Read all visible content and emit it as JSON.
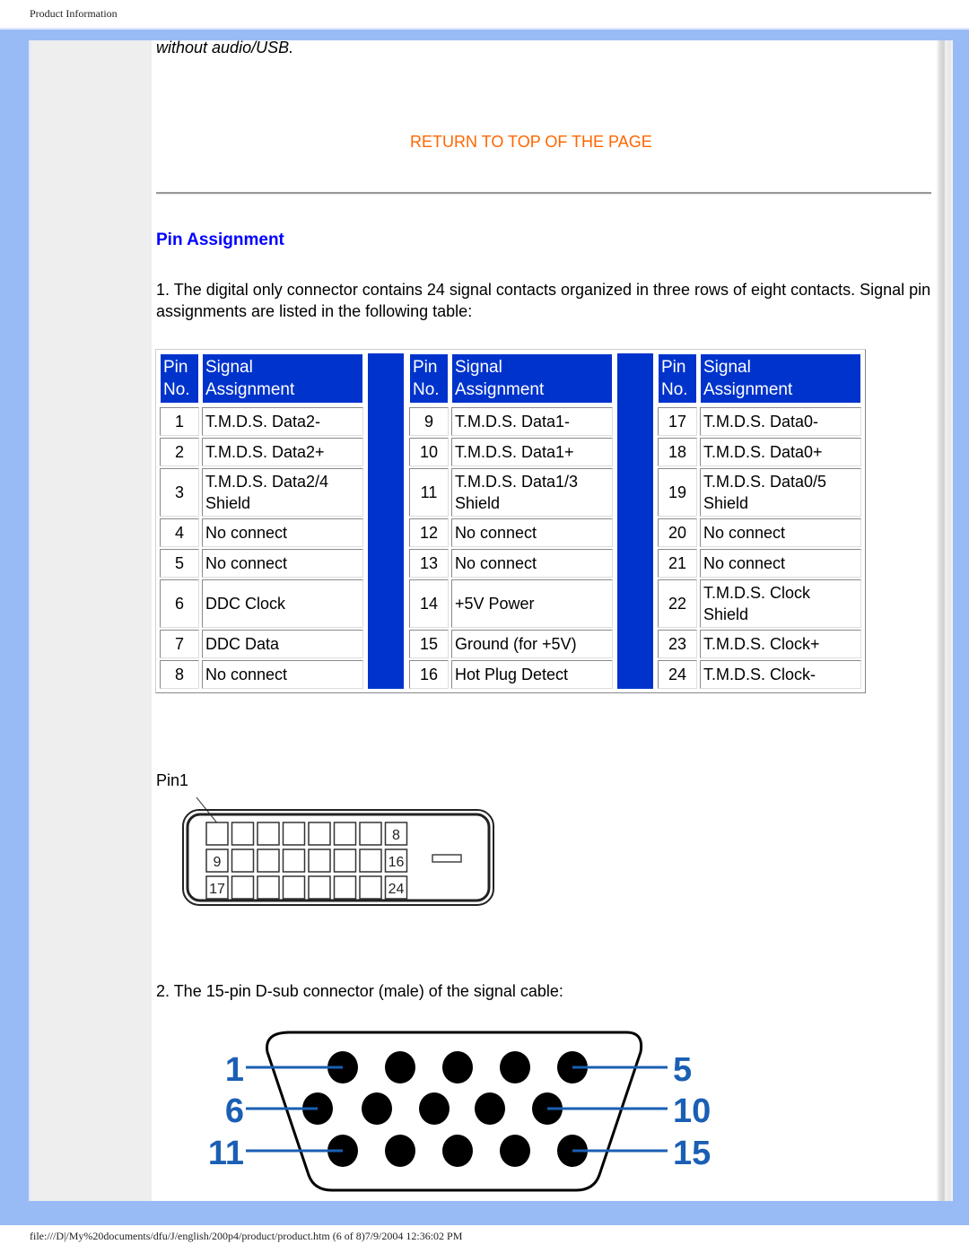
{
  "header": {
    "title": "Product Information"
  },
  "content": {
    "intro_italic": "without audio/USB.",
    "return_link": "RETURN TO TOP OF THE PAGE",
    "section_title": "Pin Assignment",
    "para1": "1. The digital only connector contains 24 signal contacts organized in three rows of eight contacts. Signal pin assignments are listed in the following table:",
    "table": {
      "header_pin": [
        "Pin",
        "No."
      ],
      "header_signal": [
        "Signal",
        "Assignment"
      ],
      "groups": [
        {
          "rows": [
            {
              "pin": "1",
              "signal": [
                "T.M.D.S. Data2-"
              ]
            },
            {
              "pin": "2",
              "signal": [
                "T.M.D.S. Data2+"
              ]
            },
            {
              "pin": "3",
              "signal": [
                "T.M.D.S. Data2/4",
                "Shield"
              ]
            },
            {
              "pin": "4",
              "signal": [
                "No connect"
              ]
            },
            {
              "pin": "5",
              "signal": [
                "No connect"
              ]
            },
            {
              "pin": "6",
              "signal": [
                "DDC Clock"
              ]
            },
            {
              "pin": "7",
              "signal": [
                "DDC Data"
              ]
            },
            {
              "pin": "8",
              "signal": [
                "No connect"
              ]
            }
          ]
        },
        {
          "rows": [
            {
              "pin": "9",
              "signal": [
                "T.M.D.S. Data1-"
              ]
            },
            {
              "pin": "10",
              "signal": [
                "T.M.D.S. Data1+"
              ]
            },
            {
              "pin": "11",
              "signal": [
                "T.M.D.S. Data1/3",
                "Shield"
              ]
            },
            {
              "pin": "12",
              "signal": [
                "No connect"
              ]
            },
            {
              "pin": "13",
              "signal": [
                "No connect"
              ]
            },
            {
              "pin": "14",
              "signal": [
                "+5V Power"
              ]
            },
            {
              "pin": "15",
              "signal": [
                "Ground (for +5V)"
              ]
            },
            {
              "pin": "16",
              "signal": [
                "Hot Plug Detect"
              ]
            }
          ]
        },
        {
          "rows": [
            {
              "pin": "17",
              "signal": [
                "T.M.D.S. Data0-"
              ]
            },
            {
              "pin": "18",
              "signal": [
                "T.M.D.S. Data0+"
              ]
            },
            {
              "pin": "19",
              "signal": [
                "T.M.D.S. Data0/5",
                "Shield"
              ]
            },
            {
              "pin": "20",
              "signal": [
                "No connect"
              ]
            },
            {
              "pin": "21",
              "signal": [
                "No connect"
              ]
            },
            {
              "pin": "22",
              "signal": [
                "T.M.D.S. Clock",
                "Shield"
              ]
            },
            {
              "pin": "23",
              "signal": [
                "T.M.D.S. Clock+"
              ]
            },
            {
              "pin": "24",
              "signal": [
                "T.M.D.S. Clock-"
              ]
            }
          ]
        }
      ]
    },
    "dvi_diagram": {
      "label": "Pin1",
      "pin_labels": {
        "row1_end": "8",
        "row2_start": "9",
        "row2_end": "16",
        "row3_start": "17",
        "row3_end": "24"
      }
    },
    "para2": "2. The 15-pin D-sub connector (male) of the signal cable:",
    "vga_diagram": {
      "labels_left": [
        "1",
        "6",
        "11"
      ],
      "labels_right": [
        "5",
        "10",
        "15"
      ],
      "label_color": "#1a5fb4"
    }
  },
  "footer": {
    "text": "file:///D|/My%20documents/dfu/J/english/200p4/product/product.htm (6 of 8)7/9/2004 12:36:02 PM"
  },
  "colors": {
    "frame": "#99bbf5",
    "table_header": "#0033cc",
    "link": "#ff6600",
    "section_title": "#0000ff"
  }
}
